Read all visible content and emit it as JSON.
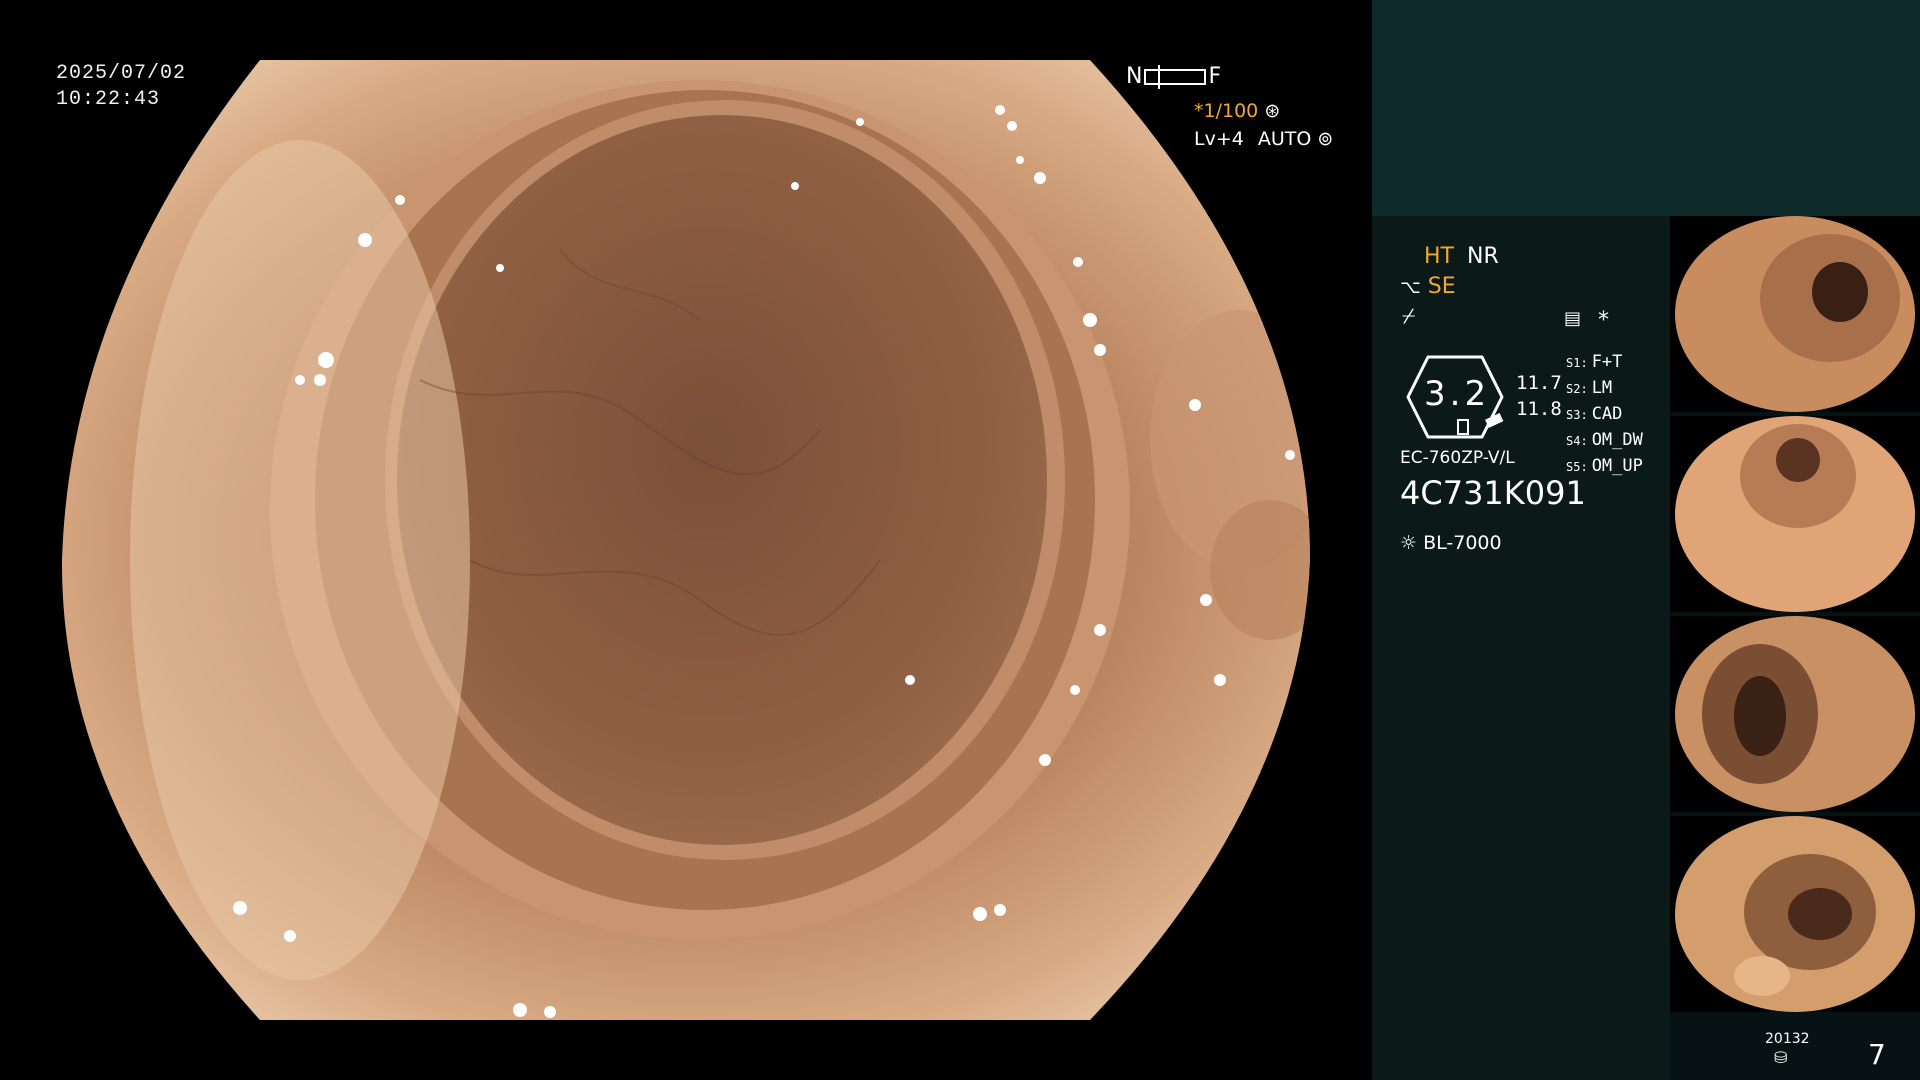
{
  "overlay": {
    "date": "2025/07/02",
    "time": "10:22:43",
    "scale_near": "N",
    "scale_far": "F",
    "zoom": "*1/100",
    "level": "Lv+4",
    "mode": "AUTO"
  },
  "panel": {
    "ht": "HT",
    "nr": "NR",
    "se": "SE",
    "gauge_value": "3.2",
    "val_top": "11.7",
    "val_bottom": "11.8",
    "scope_model": "EC-760ZP-V/L",
    "serial": "4C731K091",
    "light_source": "BL-7000",
    "asterisk": "*",
    "settings": [
      {
        "key": "S1:",
        "value": "F+T"
      },
      {
        "key": "S2:",
        "value": "LM"
      },
      {
        "key": "S3:",
        "value": "CAD"
      },
      {
        "key": "S4:",
        "value": "OM_DW"
      },
      {
        "key": "S5:",
        "value": "OM_UP"
      }
    ],
    "storage_count": "20132",
    "page_number": "7"
  },
  "colors": {
    "accent": "#f0a830",
    "panel_bg": "#0b1919",
    "panel_top": "#0e2a2b"
  }
}
